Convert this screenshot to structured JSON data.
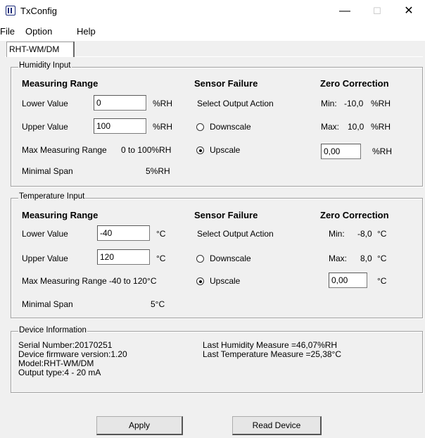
{
  "window": {
    "title": "TxConfig",
    "minimize": "—",
    "maximize": "☐",
    "close": "✕"
  },
  "menu": {
    "file": "File",
    "option": "Option",
    "help": "Help"
  },
  "tab": {
    "label": "RHT-WM/DM"
  },
  "humidity": {
    "group_title": "Humidity Input",
    "measuring_range": "Measuring Range",
    "lower_label": "Lower Value",
    "lower_value": "0",
    "lower_unit": "%RH",
    "upper_label": "Upper Value",
    "upper_value": "100",
    "upper_unit": "%RH",
    "max_range_label": "Max Measuring Range",
    "max_range_value": "0 to 100%RH",
    "min_span_label": "Minimal Span",
    "min_span_value": "5%RH",
    "sensor_failure": "Sensor Failure",
    "select_output": "Select Output Action",
    "downscale": "Downscale",
    "upscale": "Upscale",
    "zero_correction": "Zero Correction",
    "min_label": "Min:",
    "min_value": "-10,0",
    "min_unit": "%RH",
    "max_label": "Max:",
    "max_value": "10,0",
    "max_unit": "%RH",
    "zero_value": "0,00",
    "zero_unit": "%RH"
  },
  "temperature": {
    "group_title": "Temperature Input",
    "measuring_range": "Measuring Range",
    "lower_label": "Lower Value",
    "lower_value": "-40",
    "lower_unit": "°C",
    "upper_label": "Upper Value",
    "upper_value": "120",
    "upper_unit": "°C",
    "max_range_label": "Max Measuring Range",
    "max_range_value": "-40 to 120°C",
    "min_span_label": "Minimal Span",
    "min_span_value": "5°C",
    "sensor_failure": "Sensor Failure",
    "select_output": "Select Output Action",
    "downscale": "Downscale",
    "upscale": "Upscale",
    "zero_correction": "Zero Correction",
    "min_label": "Min:",
    "min_value": "-8,0",
    "min_unit": "°C",
    "max_label": "Max:",
    "max_value": "8,0",
    "max_unit": "°C",
    "zero_value": "0,00",
    "zero_unit": "°C"
  },
  "device": {
    "group_title": "Device Information",
    "serial": "Serial Number:20170251",
    "firmware": "Device firmware version:1.20",
    "model": "Model:RHT-WM/DM",
    "output": "Output type:4 - 20 mA",
    "last_humidity": "Last Humidity Measure =46,07%RH",
    "last_temperature": "Last Temperature Measure =25,38°C"
  },
  "buttons": {
    "apply": "Apply",
    "read_device": "Read Device"
  }
}
